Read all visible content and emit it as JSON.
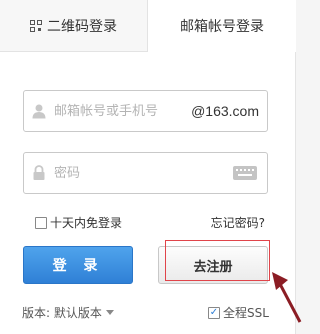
{
  "tabs": {
    "qr_label": "二维码登录",
    "mail_label": "邮箱帐号登录"
  },
  "username": {
    "placeholder": "邮箱帐号或手机号",
    "suffix": "@163.com"
  },
  "password": {
    "placeholder": "密码"
  },
  "options": {
    "remember_label": "十天内免登录",
    "forgot_label": "忘记密码?"
  },
  "buttons": {
    "login_label": "登 录",
    "register_label": "去注册"
  },
  "footer": {
    "version_label": "版本: 默认版本",
    "ssl_label": "全程SSL",
    "ssl_checked": true
  },
  "colors": {
    "accent": "#2f80d6",
    "highlight": "#e0444a",
    "arrow": "#8b1d24"
  }
}
